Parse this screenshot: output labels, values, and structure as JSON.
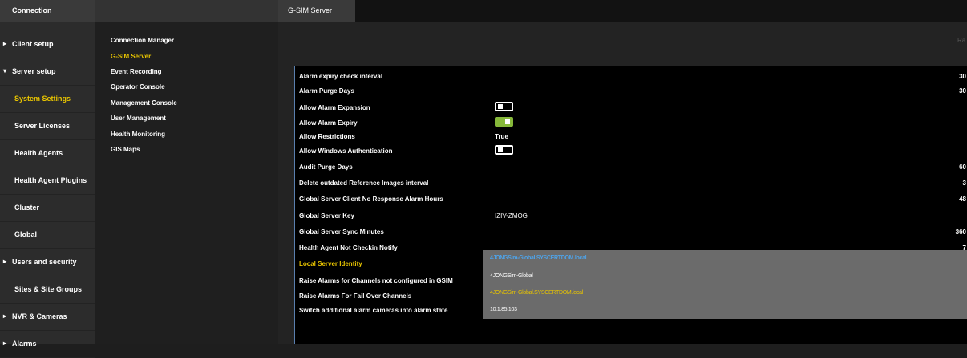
{
  "leftnav": {
    "header": "Connection",
    "items": [
      {
        "label": "Client setup",
        "caret": "▸",
        "active": false
      },
      {
        "label": "Server setup",
        "caret": "▾",
        "active": false
      },
      {
        "label": "System Settings",
        "caret": "",
        "active": true
      },
      {
        "label": "Server Licenses",
        "caret": "",
        "active": false
      },
      {
        "label": "Health Agents",
        "caret": "",
        "active": false
      },
      {
        "label": "Health Agent Plugins",
        "caret": "",
        "active": false
      },
      {
        "label": "Cluster",
        "caret": "",
        "active": false
      },
      {
        "label": "Global",
        "caret": "",
        "active": false
      },
      {
        "label": "Users and security",
        "caret": "▸",
        "active": false
      },
      {
        "label": "Sites & Site Groups",
        "caret": "",
        "active": false
      },
      {
        "label": "NVR & Cameras",
        "caret": "▸",
        "active": false
      },
      {
        "label": "Alarms",
        "caret": "▸",
        "active": false
      }
    ]
  },
  "subnav": {
    "items": [
      {
        "label": "Connection Manager",
        "active": false
      },
      {
        "label": "G-SIM Server",
        "active": true
      },
      {
        "label": "Event Recording",
        "active": false
      },
      {
        "label": "Operator Console",
        "active": false
      },
      {
        "label": "Management Console",
        "active": false
      },
      {
        "label": "User Management",
        "active": false
      },
      {
        "label": "Health Monitoring",
        "active": false
      },
      {
        "label": "GIS Maps",
        "active": false
      }
    ]
  },
  "tabs": {
    "active": "G-SIM Server"
  },
  "toolbar": {
    "hint": "Ra"
  },
  "settings": [
    {
      "name": "Alarm expiry check interval",
      "value": "30",
      "type": "number"
    },
    {
      "name": "Alarm Purge Days",
      "value": "30",
      "type": "number"
    },
    {
      "name": "Allow Alarm Expansion",
      "value": "off",
      "type": "toggle"
    },
    {
      "name": "Allow Alarm Expiry",
      "value": "on",
      "type": "toggle"
    },
    {
      "name": "Allow Restrictions",
      "value": "True",
      "type": "text"
    },
    {
      "name": "Allow Windows Authentication",
      "value": "off",
      "type": "toggle"
    },
    {
      "name": "Audit Purge Days",
      "value": "60",
      "type": "number"
    },
    {
      "name": "Delete outdated Reference Images interval",
      "value": "3",
      "type": "number"
    },
    {
      "name": "Global Server Client No Response Alarm Hours",
      "value": "48",
      "type": "number"
    },
    {
      "name": "Global Server Key",
      "value": "IZIV-ZMOG",
      "type": "text"
    },
    {
      "name": "Global Server Sync Minutes",
      "value": "360",
      "type": "number"
    },
    {
      "name": "Health Agent Not Checkin Notify",
      "value": "7",
      "type": "number"
    },
    {
      "name": "Local Server Identity",
      "value": "",
      "type": "dropdown"
    },
    {
      "name": "Raise Alarms for Channels not configured in GSIM",
      "value": "",
      "type": "dropdown"
    },
    {
      "name": "Raise Alarms For Fail Over Channels",
      "value": "",
      "type": "dropdown"
    },
    {
      "name": "Switch additional alarm cameras into alarm state",
      "value": "",
      "type": "dropdown"
    }
  ],
  "dropdown": {
    "options": [
      {
        "label": "4JONGSim-Global.SYSCERTDOM.local",
        "style": "selected"
      },
      {
        "label": "4JONGSim-Global",
        "style": "normal"
      },
      {
        "label": "4JONGSim-Global.SYSCERTDOM.local",
        "style": "gold"
      },
      {
        "label": "10.1.85.103",
        "style": "normal"
      }
    ]
  },
  "colors": {
    "accent": "#e8c400",
    "toggle_on": "#86b83a",
    "selection_blue": "#4fa3e8",
    "grid_border": "#5a7fae"
  }
}
